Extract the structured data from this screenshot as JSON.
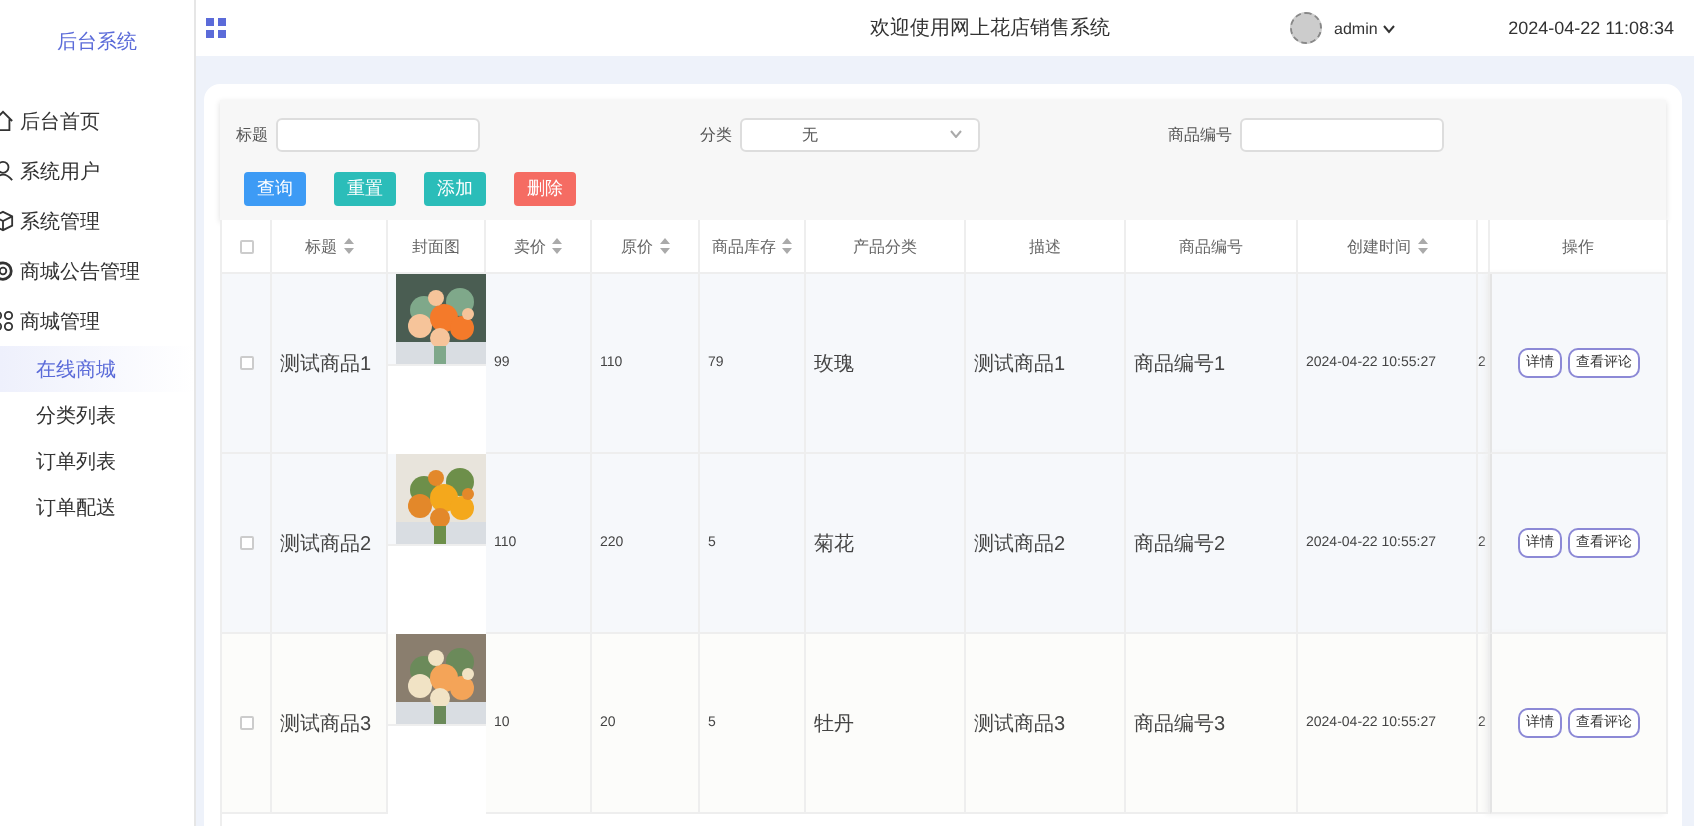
{
  "sidebar": {
    "title": "后台系统",
    "items": [
      {
        "label": "后台首页",
        "selected": false
      },
      {
        "label": "系统用户",
        "selected": false
      },
      {
        "label": "系统管理",
        "selected": false
      },
      {
        "label": "商城公告管理",
        "selected": false
      },
      {
        "label": "商城管理",
        "selected": false,
        "expanded": true,
        "children": [
          {
            "label": "在线商城",
            "selected": true
          },
          {
            "label": "分类列表",
            "selected": false
          },
          {
            "label": "订单列表",
            "selected": false
          },
          {
            "label": "订单配送",
            "selected": false
          }
        ]
      }
    ]
  },
  "header": {
    "title": "欢迎使用网上花店销售系统",
    "user": "admin",
    "datetime": "2024-04-22 11:08:34"
  },
  "filters": [
    {
      "label": "标题",
      "kind": "input"
    },
    {
      "label": "分类",
      "kind": "select",
      "value": "无"
    },
    {
      "label": "商品编号",
      "kind": "input"
    }
  ],
  "actions": [
    {
      "label": "查询",
      "color": "#3d9bf5"
    },
    {
      "label": "重置",
      "color": "#2bbdb9"
    },
    {
      "label": "添加",
      "color": "#2bbdb9"
    },
    {
      "label": "删除",
      "color": "#f56c63"
    }
  ],
  "table": {
    "select_all": {
      "checked": false
    },
    "columns": [
      {
        "label": "标题",
        "sortable": true
      },
      {
        "label": "封面图",
        "sortable": false
      },
      {
        "label": "卖价",
        "sortable": true
      },
      {
        "label": "原价",
        "sortable": true
      },
      {
        "label": "商品库存",
        "sortable": true
      },
      {
        "label": "产品分类",
        "sortable": false
      },
      {
        "label": "描述",
        "sortable": false
      },
      {
        "label": "商品编号",
        "sortable": false
      },
      {
        "label": "创建时间",
        "sortable": true
      },
      {
        "label": "操作",
        "sortable": false
      }
    ],
    "rows": [
      {
        "checked": false,
        "title": "测试商品1",
        "cover": {
          "kind": "picture"
        },
        "price": "99",
        "original_price": "110",
        "stock": "79",
        "category": "玫瑰",
        "description": "测试商品1",
        "code": "商品编号1",
        "created": "2024-04-22 10:55:27",
        "column_10": "2",
        "buttons": [
          "详情",
          "查看评论"
        ]
      },
      {
        "checked": false,
        "title": "测试商品2",
        "cover": {
          "kind": "picture"
        },
        "price": "110",
        "original_price": "220",
        "stock": "5",
        "category": "菊花",
        "description": "测试商品2",
        "code": "商品编号2",
        "created": "2024-04-22 10:55:27",
        "column_10": "2",
        "buttons": [
          "详情",
          "查看评论"
        ]
      },
      {
        "checked": false,
        "title": "测试商品3",
        "cover": {
          "kind": "picture"
        },
        "price": "10",
        "original_price": "20",
        "stock": "5",
        "category": "牡丹",
        "description": "测试商品3",
        "code": "商品编号3",
        "created": "2024-04-22 10:55:27",
        "column_10": "2",
        "buttons": [
          "详情",
          "查看评论"
        ]
      }
    ]
  }
}
